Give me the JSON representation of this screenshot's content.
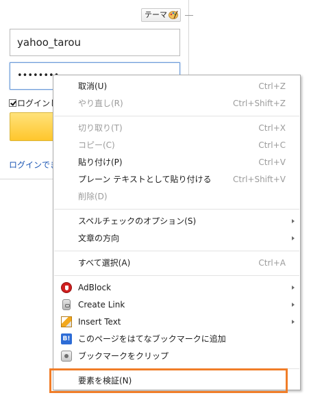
{
  "login": {
    "theme_label": "テーマ",
    "username_value": "yahoo_tarou",
    "password_value": "••••••••",
    "remember_label": "ログインし",
    "help_link": "ログインでき"
  },
  "context_menu": {
    "groups": [
      [
        {
          "label": "取消(U)",
          "shortcut": "Ctrl+Z",
          "disabled": false
        },
        {
          "label": "やり直し(R)",
          "shortcut": "Ctrl+Shift+Z",
          "disabled": true
        }
      ],
      [
        {
          "label": "切り取り(T)",
          "shortcut": "Ctrl+X",
          "disabled": true
        },
        {
          "label": "コピー(C)",
          "shortcut": "Ctrl+C",
          "disabled": true
        },
        {
          "label": "貼り付け(P)",
          "shortcut": "Ctrl+V",
          "disabled": false
        },
        {
          "label": "プレーン テキストとして貼り付ける",
          "shortcut": "Ctrl+Shift+V",
          "disabled": false
        },
        {
          "label": "削除(D)",
          "shortcut": "",
          "disabled": true
        }
      ],
      [
        {
          "label": "スペルチェックのオプション(S)",
          "submenu": true
        },
        {
          "label": "文章の方向",
          "submenu": true
        }
      ],
      [
        {
          "label": "すべて選択(A)",
          "shortcut": "Ctrl+A"
        }
      ],
      [
        {
          "label": "AdBlock",
          "icon": "adblock-icon",
          "submenu": true
        },
        {
          "label": "Create Link",
          "icon": "link-icon",
          "submenu": true
        },
        {
          "label": "Insert Text",
          "icon": "pencil-icon",
          "submenu": true
        },
        {
          "label": "このページをはてなブックマークに追加",
          "icon": "hatena-bookmark-icon"
        },
        {
          "label": "ブックマークをクリップ",
          "icon": "clip-icon"
        }
      ],
      [
        {
          "label": "要素を検証(N)"
        }
      ]
    ],
    "hatena_icon_text": "B!",
    "highlight_color": "#f07d28"
  }
}
